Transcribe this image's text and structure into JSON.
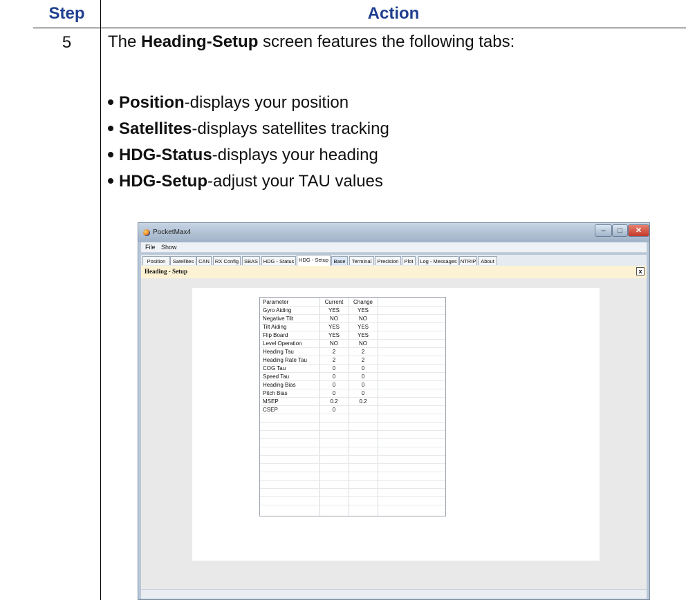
{
  "header": {
    "step": "Step",
    "action": "Action"
  },
  "step_number": "5",
  "intro": {
    "pre": "The ",
    "bold": "Heading-Setup",
    "post": " screen features the following tabs:"
  },
  "bullets": [
    {
      "bold": "Position",
      "text": "-displays your position"
    },
    {
      "bold": "Satellites",
      "text": "-displays satellites tracking"
    },
    {
      "bold": "HDG-Status",
      "text": "-displays your heading"
    },
    {
      "bold": "HDG-Setup",
      "text": "-adjust your TAU values"
    }
  ],
  "app": {
    "title": "PocketMax4",
    "menu": [
      "File",
      "Show"
    ],
    "tabs": [
      "Position",
      "Satellites",
      "CAN",
      "RX Config",
      "SBAS",
      "HDG - Status",
      "HDG - Setup",
      "Base",
      "Terminal",
      "Precision",
      "Plot",
      "Log - Messages",
      "NTRIP",
      "About"
    ],
    "active_tab": "HDG - Setup",
    "panel_title": "Heading - Setup",
    "panel_close": "x",
    "table": {
      "headers": [
        "Parameter",
        "Current",
        "Change"
      ],
      "rows": [
        [
          "Gyro Aiding",
          "YES",
          "YES"
        ],
        [
          "Negative Tilt",
          "NO",
          "NO"
        ],
        [
          "Tilt Aiding",
          "YES",
          "YES"
        ],
        [
          "Flip Board",
          "YES",
          "YES"
        ],
        [
          "Level Operation",
          "NO",
          "NO"
        ],
        [
          "Heading Tau",
          "2",
          "2"
        ],
        [
          "Heading Rate Tau",
          "2",
          "2"
        ],
        [
          "COG Tau",
          "0",
          "0"
        ],
        [
          "Speed Tau",
          "0",
          "0"
        ],
        [
          "Heading Bias",
          "0",
          "0"
        ],
        [
          "Pitch Bias",
          "0",
          "0"
        ],
        [
          "MSEP",
          "0.2",
          "0.2"
        ],
        [
          "CSEP",
          "0",
          ""
        ]
      ]
    }
  },
  "colors": {
    "header_text": "#1f3f8f",
    "panel_header_bg": "#fdf3d4",
    "window_frame": "#b9c8d9"
  }
}
